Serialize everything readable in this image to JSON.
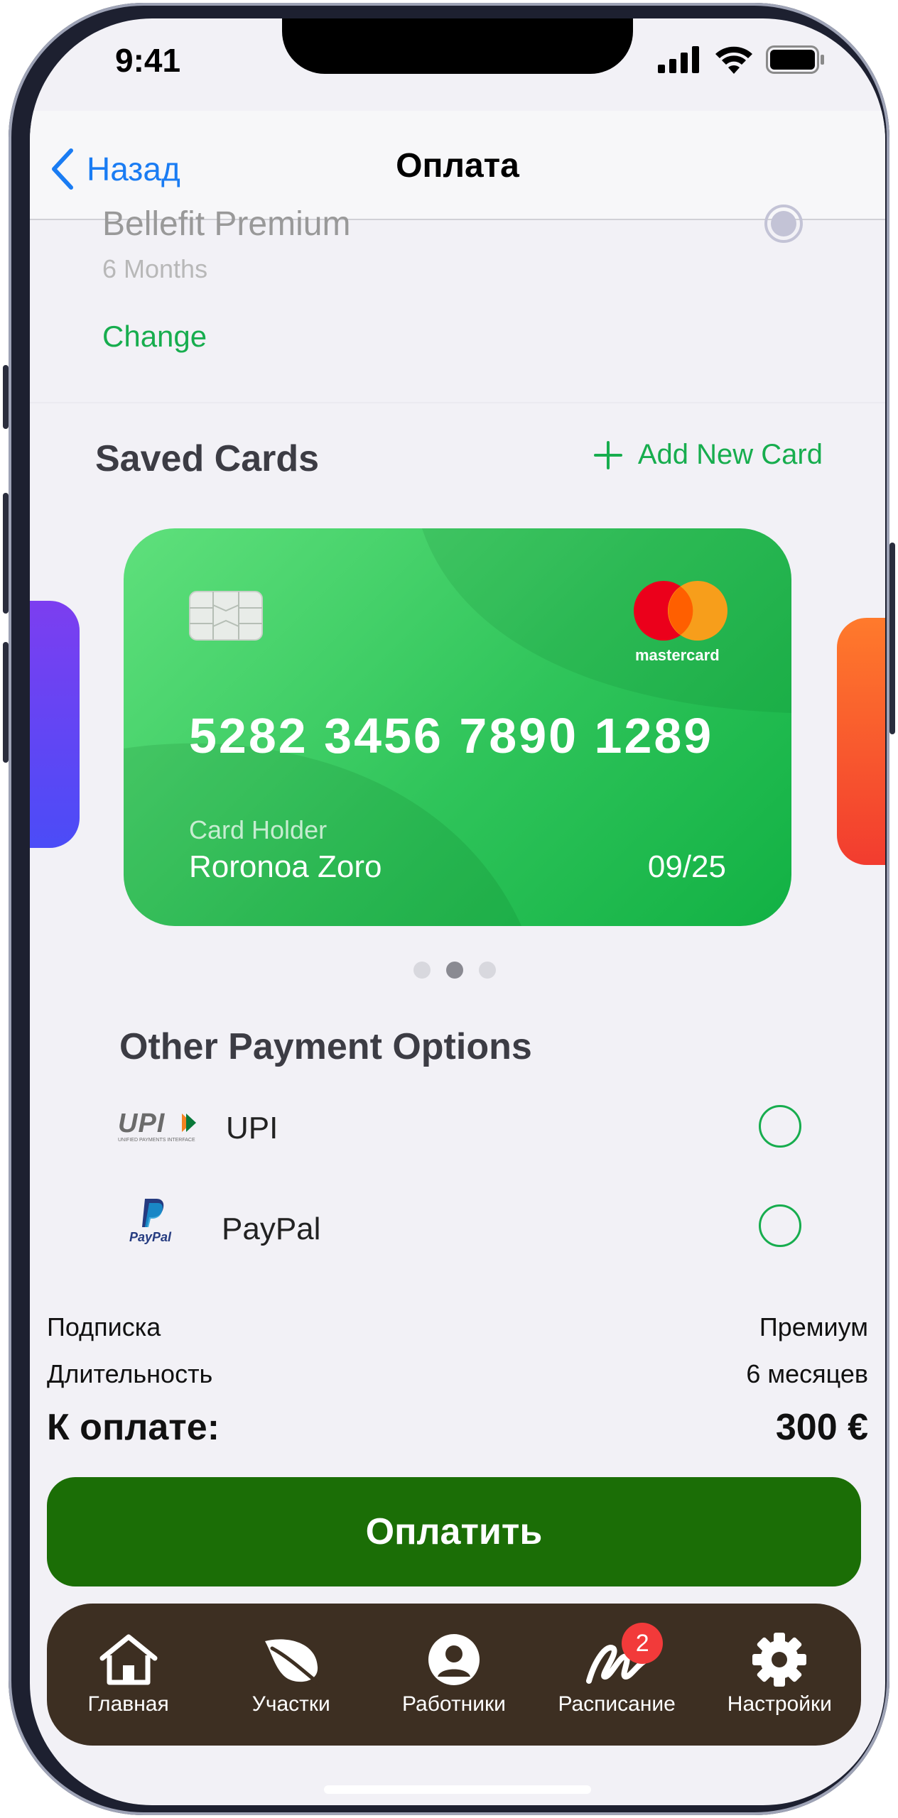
{
  "status_bar": {
    "time": "9:41"
  },
  "navbar": {
    "back_label": "Назад",
    "title": "Оплата"
  },
  "plan": {
    "name": "Bellefit Premium",
    "duration": "6 Months",
    "change_label": "Change"
  },
  "saved_cards": {
    "title": "Saved Cards",
    "add_label": "Add New Card",
    "card": {
      "number": "5282 3456 7890 1289",
      "holder_label": "Card Holder",
      "holder_name": "Roronoa Zoro",
      "expiry": "09/25",
      "brand": "mastercard"
    },
    "page_count": 3,
    "active_page": 2
  },
  "other_payment": {
    "title": "Other Payment Options",
    "options": [
      {
        "label": "UPI",
        "logo_text": "UPI",
        "logo_subtext": "UNIFIED PAYMENTS INTERFACE",
        "selected": false
      },
      {
        "label": "PayPal",
        "logo_text": "PayPal",
        "selected": false
      }
    ]
  },
  "summary": {
    "subscription_label": "Подписка",
    "subscription_value": "Премиум",
    "duration_label": "Длительность",
    "duration_value": "6 месяцев",
    "total_label": "К оплате:",
    "total_value": "300 €"
  },
  "pay_button": "Оплатить",
  "tabbar": {
    "tabs": [
      {
        "label": "Главная",
        "icon": "home-icon"
      },
      {
        "label": "Участки",
        "icon": "leaf-icon"
      },
      {
        "label": "Работники",
        "icon": "user-icon"
      },
      {
        "label": "Расписание",
        "icon": "signature-icon",
        "badge": "2"
      },
      {
        "label": "Настройки",
        "icon": "gear-icon"
      }
    ]
  },
  "colors": {
    "accent_green": "#17ad4e",
    "pay_button": "#1b6e06",
    "tabbar": "#3d2f22",
    "link_blue": "#1a7cf3",
    "badge_red": "#f23a3a"
  }
}
